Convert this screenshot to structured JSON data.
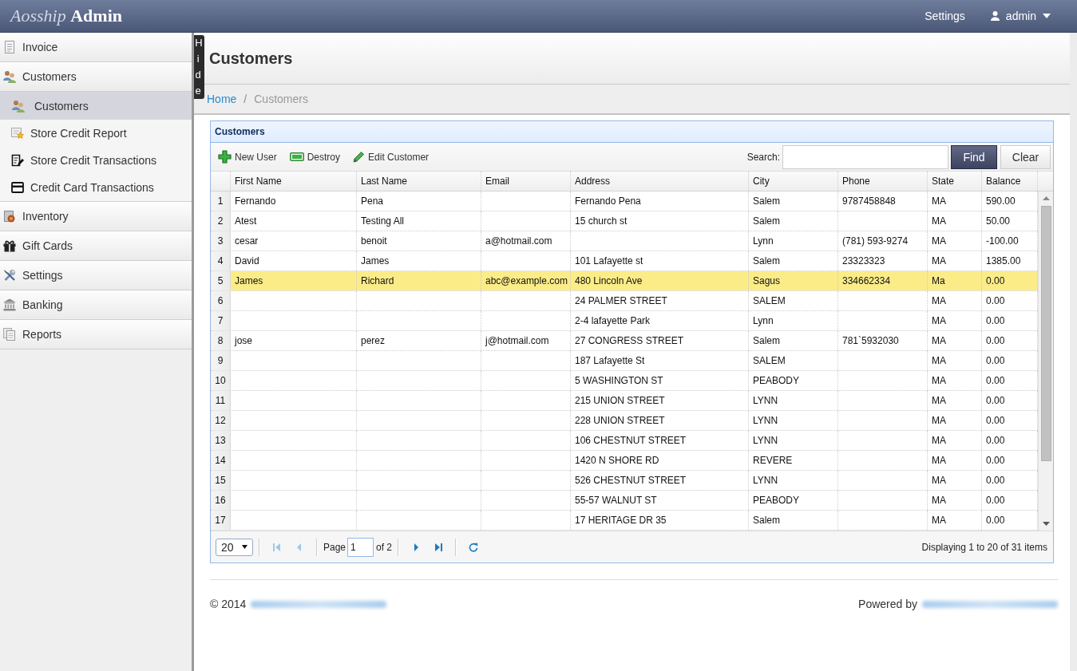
{
  "header": {
    "brand": {
      "light": "Aosship",
      "bold": "Admin"
    },
    "links": [
      {
        "label": "Settings"
      }
    ],
    "user": {
      "name": "admin"
    }
  },
  "sidebar": {
    "items": [
      {
        "label": "Invoice",
        "selected": false
      },
      {
        "label": "Customers",
        "selected": false,
        "children": [
          {
            "label": "Customers",
            "selected": true
          },
          {
            "label": "Store Credit Report",
            "selected": false
          },
          {
            "label": "Store Credit Transactions",
            "selected": false
          },
          {
            "label": "Credit Card Transactions",
            "selected": false
          }
        ]
      },
      {
        "label": "Inventory",
        "selected": false
      },
      {
        "label": "Gift Cards",
        "selected": false
      },
      {
        "label": "Settings",
        "selected": false
      },
      {
        "label": "Banking",
        "selected": false
      },
      {
        "label": "Reports",
        "selected": false
      }
    ]
  },
  "hide_tab": {
    "label": "Hide"
  },
  "page_title": "Customers",
  "breadcrumb": {
    "separator": "/",
    "items": [
      {
        "label": "Home",
        "current": false
      },
      {
        "label": "Customers",
        "current": true
      }
    ]
  },
  "panel": {
    "title": "Customers",
    "toolbar": [
      {
        "label": "New User",
        "kind": "add"
      },
      {
        "label": "Destroy",
        "kind": "remove"
      },
      {
        "label": "Edit Customer",
        "kind": "edit"
      }
    ],
    "search": {
      "label": "Search:"
    },
    "buttons": [
      {
        "label": "Find",
        "kind": "primary"
      },
      {
        "label": "Clear",
        "kind": "secondary"
      }
    ],
    "table": {
      "columns": [
        "First Name",
        "Last Name",
        "Email",
        "Address",
        "City",
        "Phone",
        "State",
        "Balance"
      ],
      "rows": [
        {
          "number": "1",
          "selected": false,
          "first_name": "Fernando",
          "last_name": "Pena",
          "address": "Fernando Pena",
          "city": "Salem",
          "phone": "9787458848",
          "state": "MA",
          "balance": "590.00"
        },
        {
          "number": "2",
          "selected": false,
          "first_name": "Atest",
          "last_name": "Testing All",
          "address": "15 church st",
          "city": "Salem",
          "state": "MA",
          "balance": "50.00"
        },
        {
          "number": "3",
          "selected": false,
          "first_name": "cesar",
          "last_name": "benoit",
          "email": "a@hotmail.com",
          "city": "Lynn",
          "phone": "(781) 593-9274",
          "state": "MA",
          "balance": "-100.00"
        },
        {
          "number": "4",
          "selected": false,
          "first_name": "David",
          "last_name": "James",
          "address": "101 Lafayette st",
          "city": "Salem",
          "phone": "23323323",
          "state": "MA",
          "balance": "1385.00"
        },
        {
          "number": "5",
          "selected": true,
          "first_name": "James",
          "last_name": "Richard",
          "email": "abc@example.com",
          "address": "480 Lincoln Ave",
          "city": "Sagus",
          "phone": "334662334",
          "state": "Ma",
          "balance": "0.00"
        },
        {
          "number": "6",
          "selected": false,
          "address": "24 PALMER STREET",
          "city": "SALEM",
          "state": "MA",
          "balance": "0.00"
        },
        {
          "number": "7",
          "selected": false,
          "address": "2-4 lafayette Park",
          "city": "Lynn",
          "state": "MA",
          "balance": "0.00"
        },
        {
          "number": "8",
          "selected": false,
          "first_name": "jose",
          "last_name": "perez",
          "email": "j@hotmail.com",
          "address": "27 CONGRESS STREET",
          "city": "Salem",
          "phone": "781`5932030",
          "state": "MA",
          "balance": "0.00"
        },
        {
          "number": "9",
          "selected": false,
          "address": "187 Lafayette St",
          "city": "SALEM",
          "state": "MA",
          "balance": "0.00"
        },
        {
          "number": "10",
          "selected": false,
          "address": "5 WASHINGTON ST",
          "city": "PEABODY",
          "state": "MA",
          "balance": "0.00"
        },
        {
          "number": "11",
          "selected": false,
          "address": "215 UNION STREET",
          "city": "LYNN",
          "state": "MA",
          "balance": "0.00"
        },
        {
          "number": "12",
          "selected": false,
          "address": "228 UNION STREET",
          "city": "LYNN",
          "state": "MA",
          "balance": "0.00"
        },
        {
          "number": "13",
          "selected": false,
          "address": "106 CHESTNUT STREET",
          "city": "LYNN",
          "state": "MA",
          "balance": "0.00"
        },
        {
          "number": "14",
          "selected": false,
          "address": "1420 N SHORE RD",
          "city": "REVERE",
          "state": "MA",
          "balance": "0.00"
        },
        {
          "number": "15",
          "selected": false,
          "address": "526 CHESTNUT STREET",
          "city": "LYNN",
          "state": "MA",
          "balance": "0.00"
        },
        {
          "number": "16",
          "selected": false,
          "address": "55-57 WALNUT ST",
          "city": "PEABODY",
          "state": "MA",
          "balance": "0.00"
        },
        {
          "number": "17",
          "selected": false,
          "address": "17 HERITAGE DR 35",
          "city": "Salem",
          "state": "MA",
          "balance": "0.00"
        }
      ]
    },
    "pagination": {
      "page_size": "20",
      "back_buttons": [
        {
          "kind": "first",
          "disabled": true
        },
        {
          "kind": "prev",
          "disabled": true
        }
      ],
      "page_label": "Page",
      "page": "1",
      "of_label": "of 2",
      "forward_buttons": [
        {
          "kind": "next",
          "disabled": false
        },
        {
          "kind": "last",
          "disabled": false
        }
      ],
      "summary": "Displaying 1 to 20 of 31 items"
    }
  },
  "footer": {
    "copyright": "© 2014",
    "powered_by": "Powered by"
  }
}
